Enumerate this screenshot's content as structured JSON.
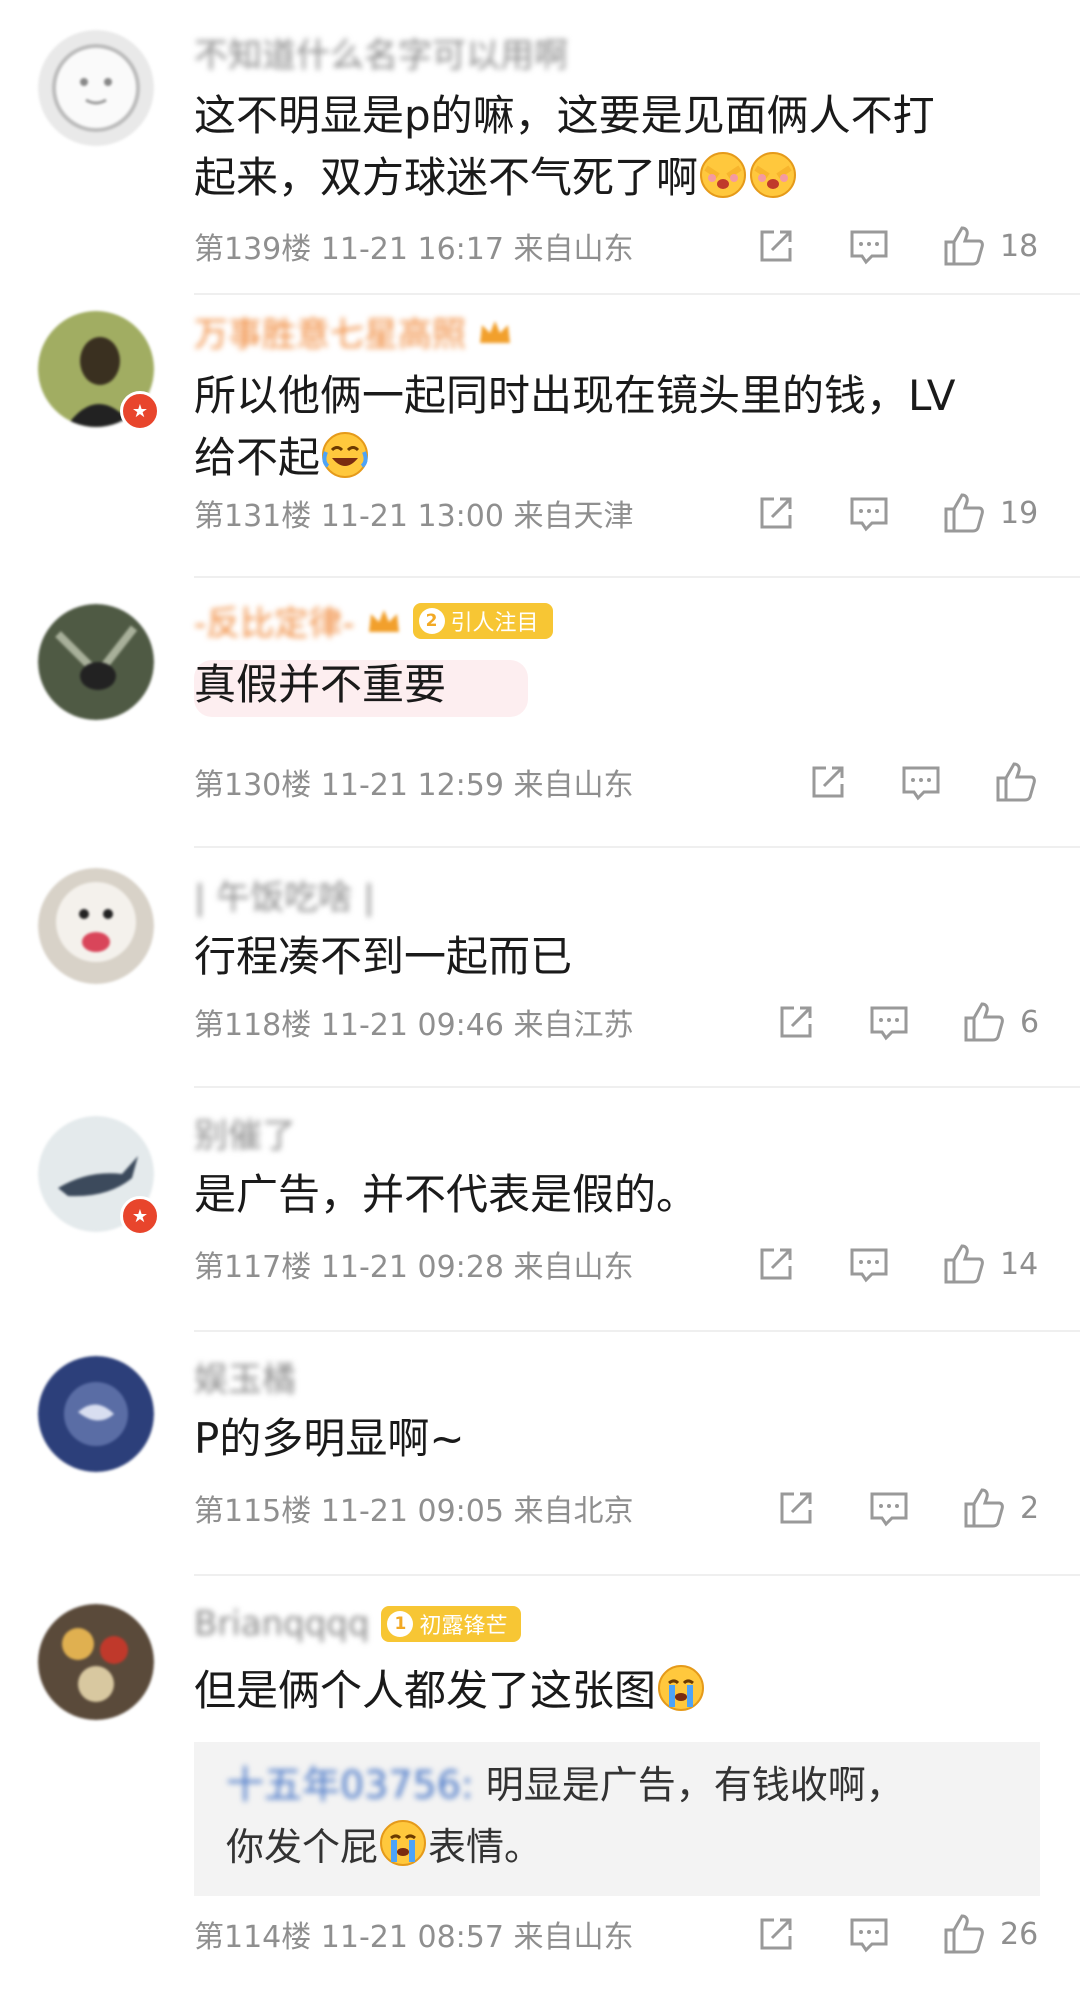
{
  "comments": [
    {
      "username": "不知道什么名字可以用啊",
      "text_line1": "这不明显是p的嘛，这要是见面俩人不打",
      "text_line2": "起来，双方球迷不气死了啊",
      "meta": "第139楼 11-21 16:17 来自山东",
      "likes": "18"
    },
    {
      "username": "万事胜意七星高照",
      "text_line1": "所以他俩一起同时出现在镜头里的钱，LV",
      "text_line2": "给不起",
      "meta": "第131楼 11-21 13:00 来自天津",
      "likes": "19"
    },
    {
      "username": "-反比定律-",
      "tag_level": "2",
      "tag_label": "引人注目",
      "text_line1": "真假并不重要",
      "meta": "第130楼 11-21 12:59 来自山东",
      "likes": ""
    },
    {
      "username": "| 午饭吃啥 |",
      "text_line1": "行程凑不到一起而已",
      "meta": "第118楼 11-21 09:46 来自江苏",
      "likes": "6"
    },
    {
      "username": "别催了",
      "text_line1": "是广告，并不代表是假的。",
      "meta": "第117楼 11-21 09:28 来自山东",
      "likes": "14"
    },
    {
      "username": "娱玉橘",
      "text_line1": "P的多明显啊~",
      "meta": "第115楼 11-21 09:05 来自北京",
      "likes": "2"
    },
    {
      "username": "Brianqqqq",
      "tag_level": "1",
      "tag_label": "初露锋芒",
      "text_line1": "但是俩个人都发了这张图",
      "quote_name": "十五年03756:",
      "quote_line1": " 明显是广告，有钱收啊，",
      "quote_line2": "你发个屁",
      "quote_line2_end": "表情。",
      "meta": "第114楼 11-21 08:57 来自山东",
      "likes": "26"
    }
  ],
  "icons": {
    "share": "share-icon",
    "comment": "comment-icon",
    "like": "thumbs-up-icon",
    "verified": "verified-badge-icon"
  },
  "colors": {
    "username_gray": "#8a8a8a",
    "username_orange": "#f08a3c",
    "tag_gold": "#f7c634",
    "verified_red": "#e8452c",
    "quote_name_blue": "#4a78c8"
  }
}
